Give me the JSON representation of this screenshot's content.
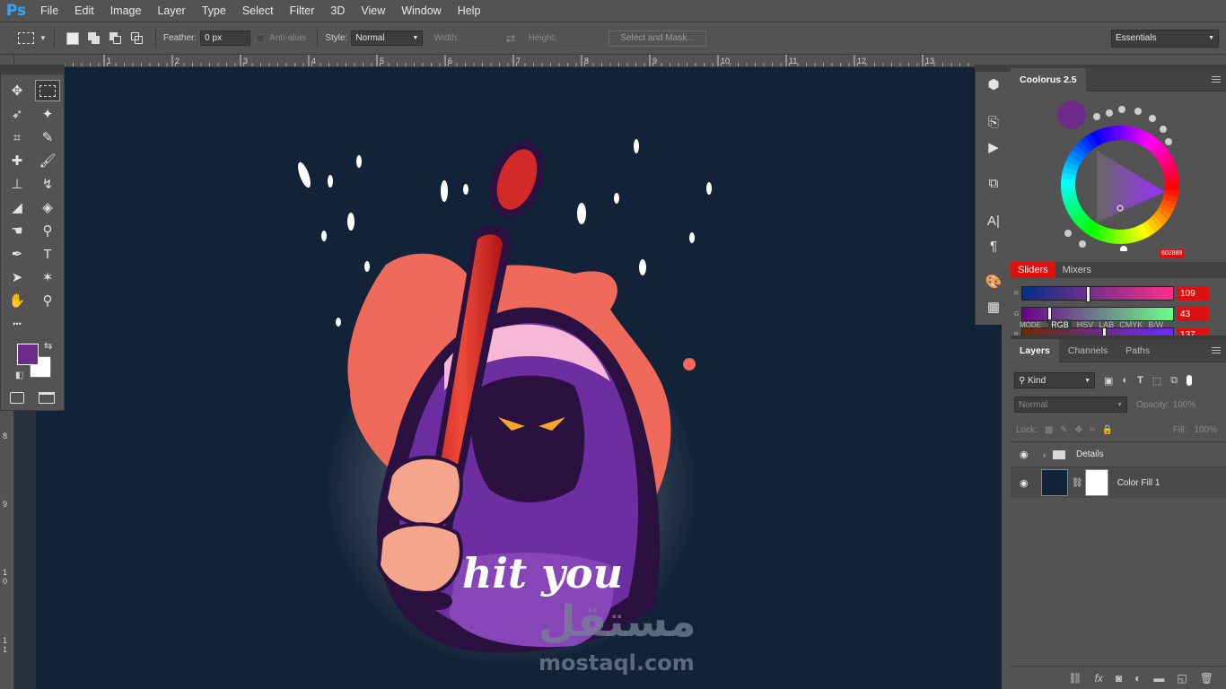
{
  "app": {
    "logo": "Ps"
  },
  "menu": [
    "File",
    "Edit",
    "Image",
    "Layer",
    "Type",
    "Select",
    "Filter",
    "3D",
    "View",
    "Window",
    "Help"
  ],
  "options": {
    "feather_label": "Feather:",
    "feather_value": "0 px",
    "antialias_label": "Anti-alias",
    "style_label": "Style:",
    "style_value": "Normal",
    "width_label": "Width:",
    "height_label": "Height:",
    "select_mask": "Select and Mask...",
    "workspace": "Essentials"
  },
  "ruler": {
    "top": [
      "1",
      "2",
      "3",
      "4",
      "5",
      "6",
      "7",
      "8",
      "9",
      "10",
      "11",
      "12",
      "13"
    ],
    "left": [
      "8",
      "9",
      "1",
      "0",
      "1",
      "1"
    ]
  },
  "tools": [
    {
      "name": "move-tool",
      "icon": "move-icon",
      "glyph": "✥"
    },
    {
      "name": "marquee-tool",
      "icon": "rect-marquee-icon",
      "glyph": ""
    },
    {
      "name": "lasso-tool",
      "icon": "lasso-icon",
      "glyph": "➶"
    },
    {
      "name": "magic-wand-tool",
      "icon": "magic-wand-icon",
      "glyph": "✦"
    },
    {
      "name": "crop-tool",
      "icon": "crop-icon",
      "glyph": "⌗"
    },
    {
      "name": "eyedropper-tool",
      "icon": "eyedropper-icon",
      "glyph": "✎"
    },
    {
      "name": "healing-tool",
      "icon": "bandage-icon",
      "glyph": "✚"
    },
    {
      "name": "brush-tool",
      "icon": "brush-icon",
      "glyph": "🖌"
    },
    {
      "name": "stamp-tool",
      "icon": "stamp-icon",
      "glyph": "⊥"
    },
    {
      "name": "history-brush-tool",
      "icon": "history-brush-icon",
      "glyph": "↯"
    },
    {
      "name": "eraser-tool",
      "icon": "eraser-icon",
      "glyph": "◢"
    },
    {
      "name": "bucket-tool",
      "icon": "paint-bucket-icon",
      "glyph": "◈"
    },
    {
      "name": "blur-tool",
      "icon": "smudge-icon",
      "glyph": "☚"
    },
    {
      "name": "dodge-tool",
      "icon": "dodge-icon",
      "glyph": "⚲"
    },
    {
      "name": "pen-tool",
      "icon": "pen-icon",
      "glyph": "✒"
    },
    {
      "name": "type-tool",
      "icon": "type-icon",
      "glyph": "T"
    },
    {
      "name": "path-select-tool",
      "icon": "arrow-icon",
      "glyph": "➤"
    },
    {
      "name": "shape-tool",
      "icon": "custom-shape-icon",
      "glyph": "✶"
    },
    {
      "name": "hand-tool",
      "icon": "hand-icon",
      "glyph": "✋"
    },
    {
      "name": "zoom-tool",
      "icon": "zoom-icon",
      "glyph": "⚲"
    },
    {
      "name": "more-tools",
      "icon": "ellipsis-icon",
      "glyph": "•••"
    }
  ],
  "colors": {
    "foreground": "#6d2b89",
    "background": "#ffffff",
    "canvas": "#122238",
    "accent": "#dd1010"
  },
  "coolorus": {
    "title": "Coolorus 2.5",
    "hex": "602889",
    "tabs": [
      "Sliders",
      "Mixers"
    ],
    "sliders": [
      {
        "label": "R",
        "value": "109",
        "fraction": 0.43
      },
      {
        "label": "G",
        "value": "43",
        "fraction": 0.17
      },
      {
        "label": "B",
        "value": "137",
        "fraction": 0.54
      }
    ],
    "mode_label": "MODE:",
    "modes": [
      "RGB",
      "HSV",
      "LAB",
      "CMYK",
      "B/W"
    ]
  },
  "layers_panel": {
    "tabs": [
      "Layers",
      "Channels",
      "Paths"
    ],
    "kind": "Kind",
    "blend": "Normal",
    "opacity_label": "Opacity:",
    "opacity_value": "100%",
    "lock_label": "Lock:",
    "fill_label": "Fill:",
    "fill_value": "100%",
    "layers": [
      {
        "name": "Details",
        "type": "group"
      },
      {
        "name": "Color Fill 1",
        "type": "fill"
      }
    ],
    "footer": [
      "link-icon",
      "fx-icon",
      "mask-icon",
      "adjustment-icon",
      "folder-icon",
      "new-layer-icon",
      "trash-icon"
    ]
  },
  "artwork": {
    "caption": "hit you"
  },
  "watermark": {
    "arabic": "مستقل",
    "latin": "mostaql.com"
  }
}
